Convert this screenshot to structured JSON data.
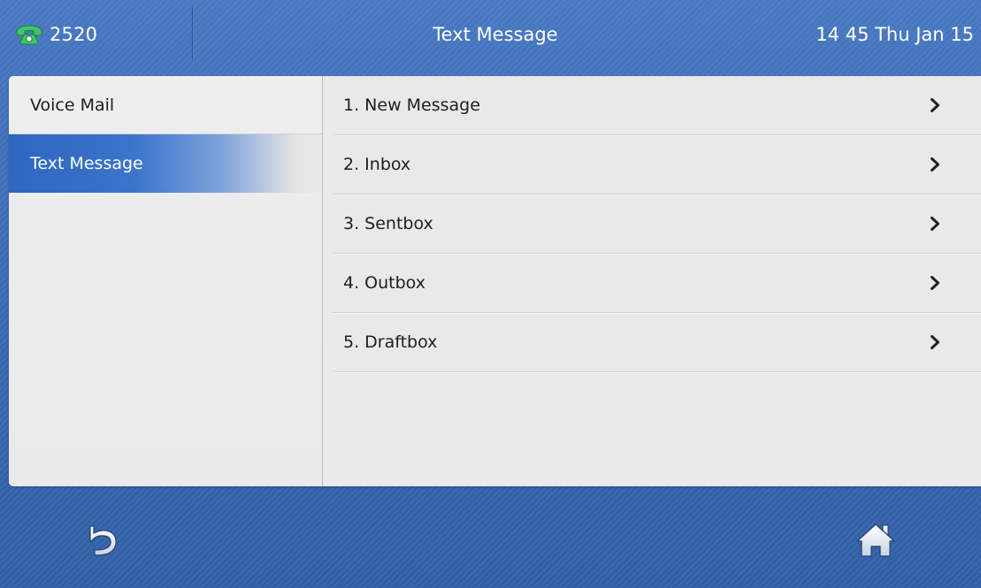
{
  "titlebar": {
    "account_number": "2520",
    "title": "Text Message",
    "clock": "14 45 Thu Jan 15",
    "phone_icon": "handset-icon",
    "phone_icon_color": "#3ec56a"
  },
  "sidebar": {
    "items": [
      {
        "label": "Voice Mail",
        "active": false
      },
      {
        "label": "Text Message",
        "active": true
      }
    ]
  },
  "menu": {
    "items": [
      {
        "label": "1. New Message",
        "icon": "chevron-right-icon"
      },
      {
        "label": "2. Inbox",
        "icon": "chevron-right-icon"
      },
      {
        "label": "3. Sentbox",
        "icon": "chevron-right-icon"
      },
      {
        "label": "4. Outbox",
        "icon": "chevron-right-icon"
      },
      {
        "label": "5. Draftbox",
        "icon": "chevron-right-icon"
      }
    ]
  },
  "softkeys": {
    "back_icon": "back-arrow-icon",
    "home_icon": "home-icon"
  },
  "colors": {
    "background": "#3e6cb4",
    "active_item": "#2f66bf",
    "panel": "#ebebeb"
  }
}
